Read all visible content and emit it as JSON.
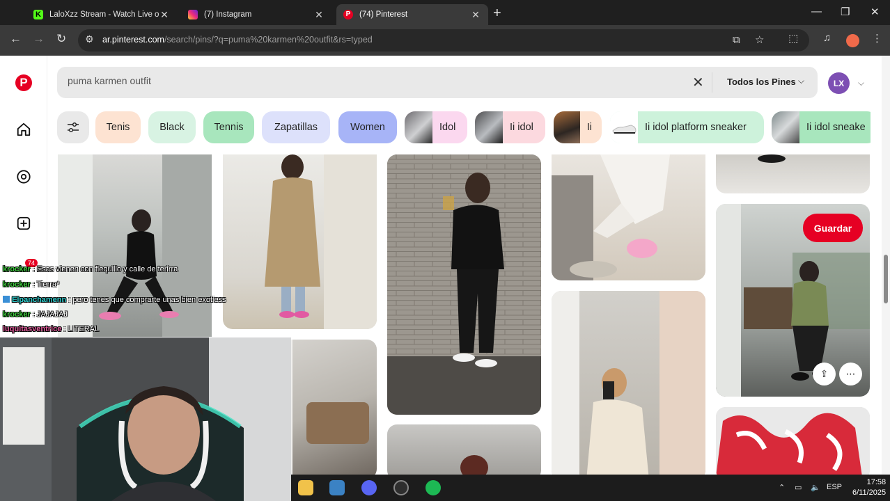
{
  "browser": {
    "tabs": [
      {
        "title": "LaloXzz Stream - Watch Live on",
        "favicon_color": "#53fc18"
      },
      {
        "title": "(7) Instagram",
        "favicon_color": "#d6249f"
      },
      {
        "title": "(74) Pinterest",
        "favicon_color": "#e60023"
      }
    ],
    "url_host": "ar.pinterest.com",
    "url_path": "/search/pins/?q=puma%20karmen%20outfit&rs=typed"
  },
  "pinterest": {
    "logo": "P",
    "search": {
      "query": "puma karmen outfit",
      "filter": "Todos los Pines"
    },
    "avatar_initials": "LX",
    "notification_count": "74",
    "chips": [
      {
        "label": "Tenis",
        "bg": "#fde3d2"
      },
      {
        "label": "Black",
        "bg": "#d8f3e3"
      },
      {
        "label": "Tennis",
        "bg": "#a8e6bd"
      },
      {
        "label": "Zapatillas",
        "bg": "#dde1fb"
      },
      {
        "label": "Women",
        "bg": "#a7b4f7"
      },
      {
        "label": "Idol",
        "bg": "#fbd8ef"
      },
      {
        "label": "Ii idol",
        "bg": "#fcd9df"
      },
      {
        "label": "Ii",
        "bg": "#fde3d2"
      },
      {
        "label": "Ii idol platform sneaker",
        "bg": "#cdf2db"
      },
      {
        "label": "Ii idol sneake",
        "bg": "#a8e6bd"
      }
    ],
    "save_label": "Guardar"
  },
  "stream_overlay": {
    "chat": [
      {
        "user": "krocker",
        "user_color": "#3dd13d",
        "text": "Esas vienen con flequillo y calle de terirra"
      },
      {
        "user": "krocker",
        "user_color": "#3dd13d",
        "text": "Tierra*"
      },
      {
        "user": "Elpanchamenn",
        "user_color": "#2fd0d0",
        "text": "pero tenes que comprarte unas bien exotiess"
      },
      {
        "user": "krocker",
        "user_color": "#3dd13d",
        "text": "JAJAJAJ"
      },
      {
        "user": "luquitasventrice",
        "user_color": "#e05a9a",
        "text": "LITERAL"
      }
    ]
  },
  "taskbar": {
    "language": "ESP",
    "time": "17:58",
    "date": "6/11/2025"
  }
}
